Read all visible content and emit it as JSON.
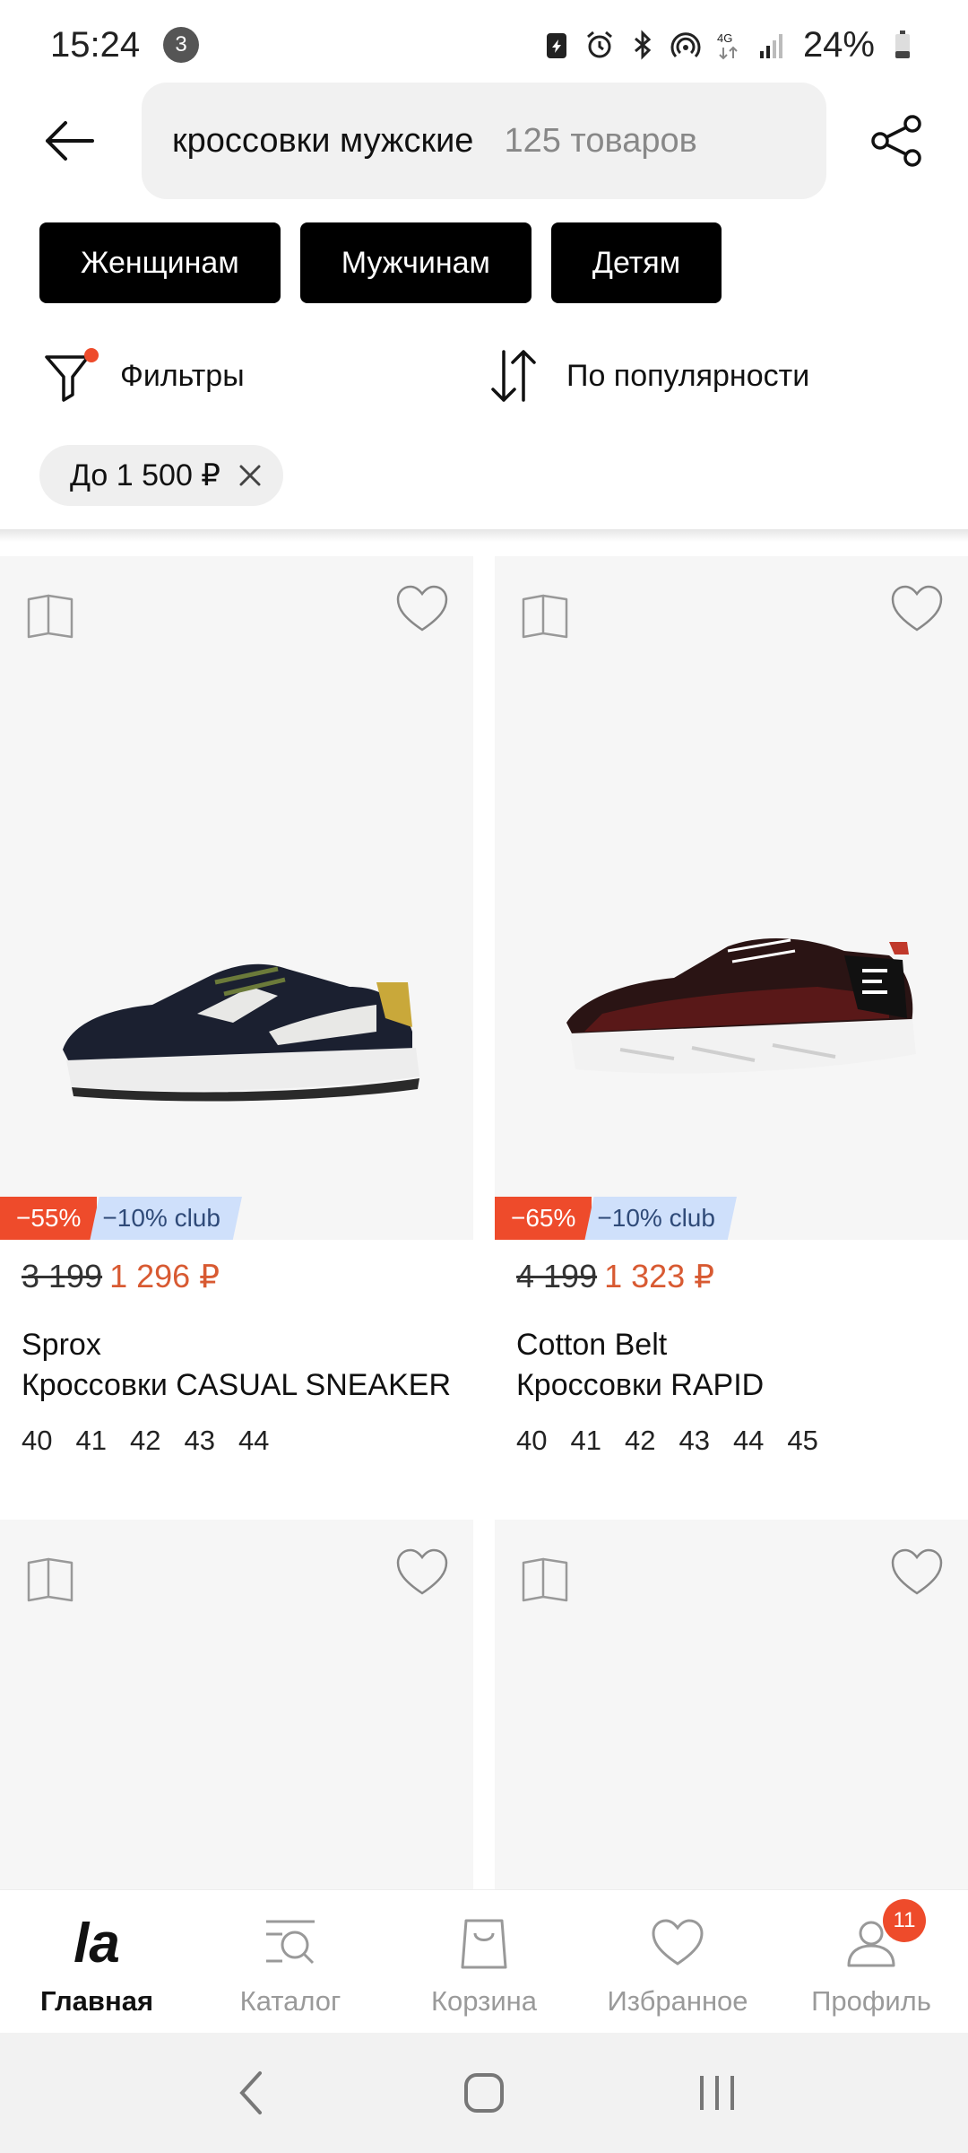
{
  "status_bar": {
    "time": "15:24",
    "notification_count": "3",
    "battery": "24%",
    "network": "4G"
  },
  "header": {
    "search_query": "кроссовки мужские",
    "result_count": "125 товаров"
  },
  "categories": [
    {
      "label": "Женщинам"
    },
    {
      "label": "Мужчинам"
    },
    {
      "label": "Детям"
    }
  ],
  "toolbar": {
    "filters_label": "Фильтры",
    "sort_label": "По популярности"
  },
  "active_filter": {
    "label": "До 1 500 ₽"
  },
  "products": [
    {
      "discount": "−55%",
      "club": "−10% club",
      "old_price": "3 199",
      "price": "1 296 ₽",
      "brand": "Sprox",
      "name": "Кроссовки CASUAL SNEAKER",
      "sizes": [
        "40",
        "41",
        "42",
        "43",
        "44"
      ]
    },
    {
      "discount": "−65%",
      "club": "−10% club",
      "old_price": "4 199",
      "price": "1 323 ₽",
      "brand": "Cotton Belt",
      "name": "Кроссовки RAPID",
      "sizes": [
        "40",
        "41",
        "42",
        "43",
        "44",
        "45"
      ]
    }
  ],
  "bottom_nav": {
    "home": "Главная",
    "catalog": "Каталог",
    "cart": "Корзина",
    "favorites": "Избранное",
    "profile": "Профиль",
    "profile_badge": "11",
    "logo": "la"
  },
  "colors": {
    "accent": "#ee4b2b",
    "price": "#d85a32",
    "club_bg": "#cfe0fb",
    "chip_bg": "#000000"
  }
}
